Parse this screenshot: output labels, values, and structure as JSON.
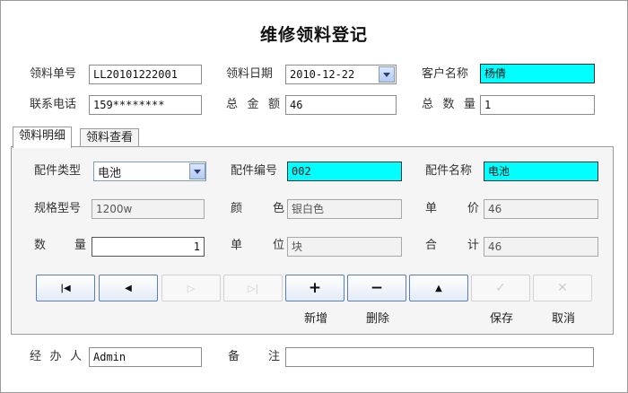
{
  "title": "维修领料登记",
  "header": {
    "order_no_label": "领料单号",
    "order_no_value": "LL20101222001",
    "date_label": "领料日期",
    "date_value": "2010-12-22",
    "customer_label": "客户名称",
    "customer_value": "杨倩",
    "phone_label": "联系电话",
    "phone_value": "159********",
    "amount_label": "总金额",
    "amount_value": "46",
    "qty_label": "总数量",
    "qty_value": "1"
  },
  "tabs": [
    "领料明细",
    "领料查看"
  ],
  "detail": {
    "type_label": "配件类型",
    "type_value": "电池",
    "code_label": "配件编号",
    "code_value": "002",
    "name_label": "配件名称",
    "name_value": "电池",
    "spec_label": "规格型号",
    "spec_value": "1200w",
    "color_label": "颜色",
    "color_value": "银白色",
    "price_label": "单价",
    "price_value": "46",
    "qty_label": "数量",
    "qty_value": "1",
    "unit_label": "单位",
    "unit_value": "块",
    "total_label": "合计",
    "total_value": "46"
  },
  "buttons": {
    "first": "|◀",
    "prev": "◀",
    "next": "▷",
    "last": "▷|",
    "add": "+",
    "delete": "−",
    "up": "▲",
    "save": "✓",
    "cancel": "✕",
    "add_caption": "新增",
    "delete_caption": "删除",
    "save_caption": "保存",
    "cancel_caption": "取消"
  },
  "footer": {
    "handler_label": "经办人",
    "handler_value": "Admin",
    "remark_label": "备注",
    "remark_value": ""
  }
}
